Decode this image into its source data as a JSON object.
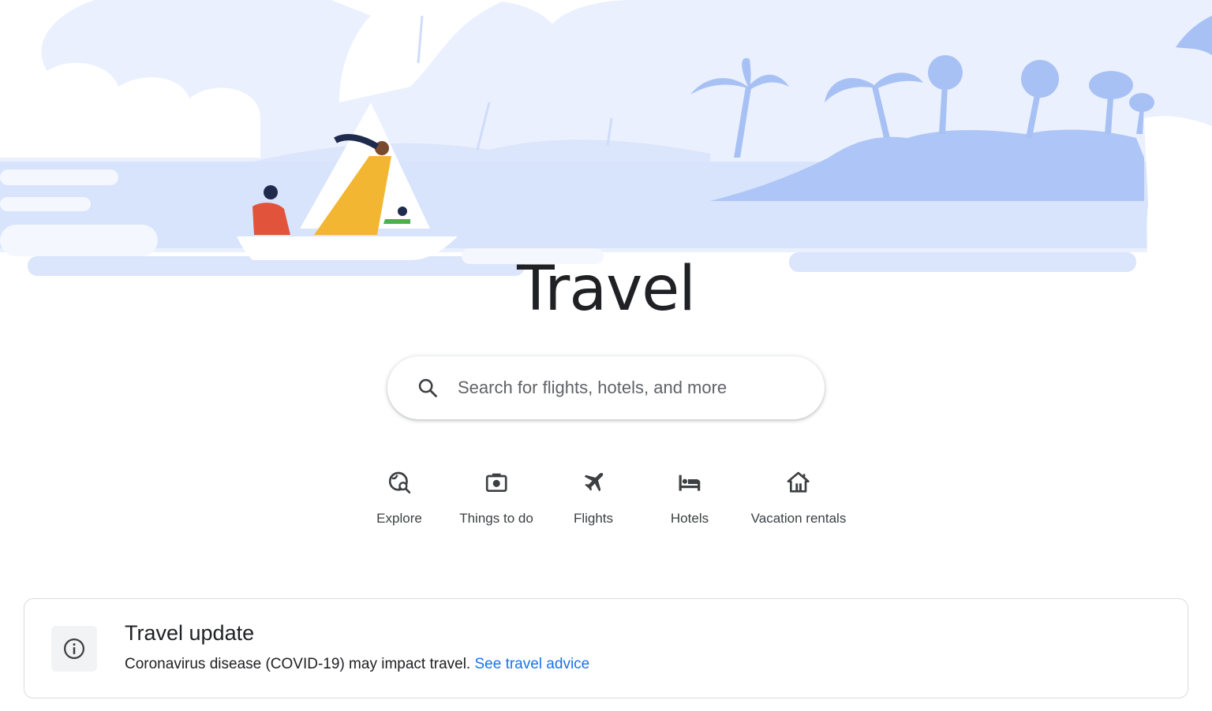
{
  "page": {
    "title": "Travel"
  },
  "search": {
    "placeholder": "Search for flights, hotels, and more",
    "icon": "search-icon"
  },
  "quick_links": [
    {
      "label": "Explore",
      "icon": "explore-globe-icon"
    },
    {
      "label": "Things to do",
      "icon": "camera-icon"
    },
    {
      "label": "Flights",
      "icon": "airplane-icon"
    },
    {
      "label": "Hotels",
      "icon": "bed-icon"
    },
    {
      "label": "Vacation rentals",
      "icon": "house-icon"
    }
  ],
  "notice": {
    "title": "Travel update",
    "text": "Coronavirus disease (COVID-19) may impact travel.",
    "link_label": "See travel advice",
    "icon": "info-icon"
  },
  "colors": {
    "sky": "#eaf0fd",
    "water": "#d8e3fc",
    "island": "#aec6f7",
    "link": "#1a73e8",
    "text": "#202124",
    "label": "#3c4043"
  }
}
